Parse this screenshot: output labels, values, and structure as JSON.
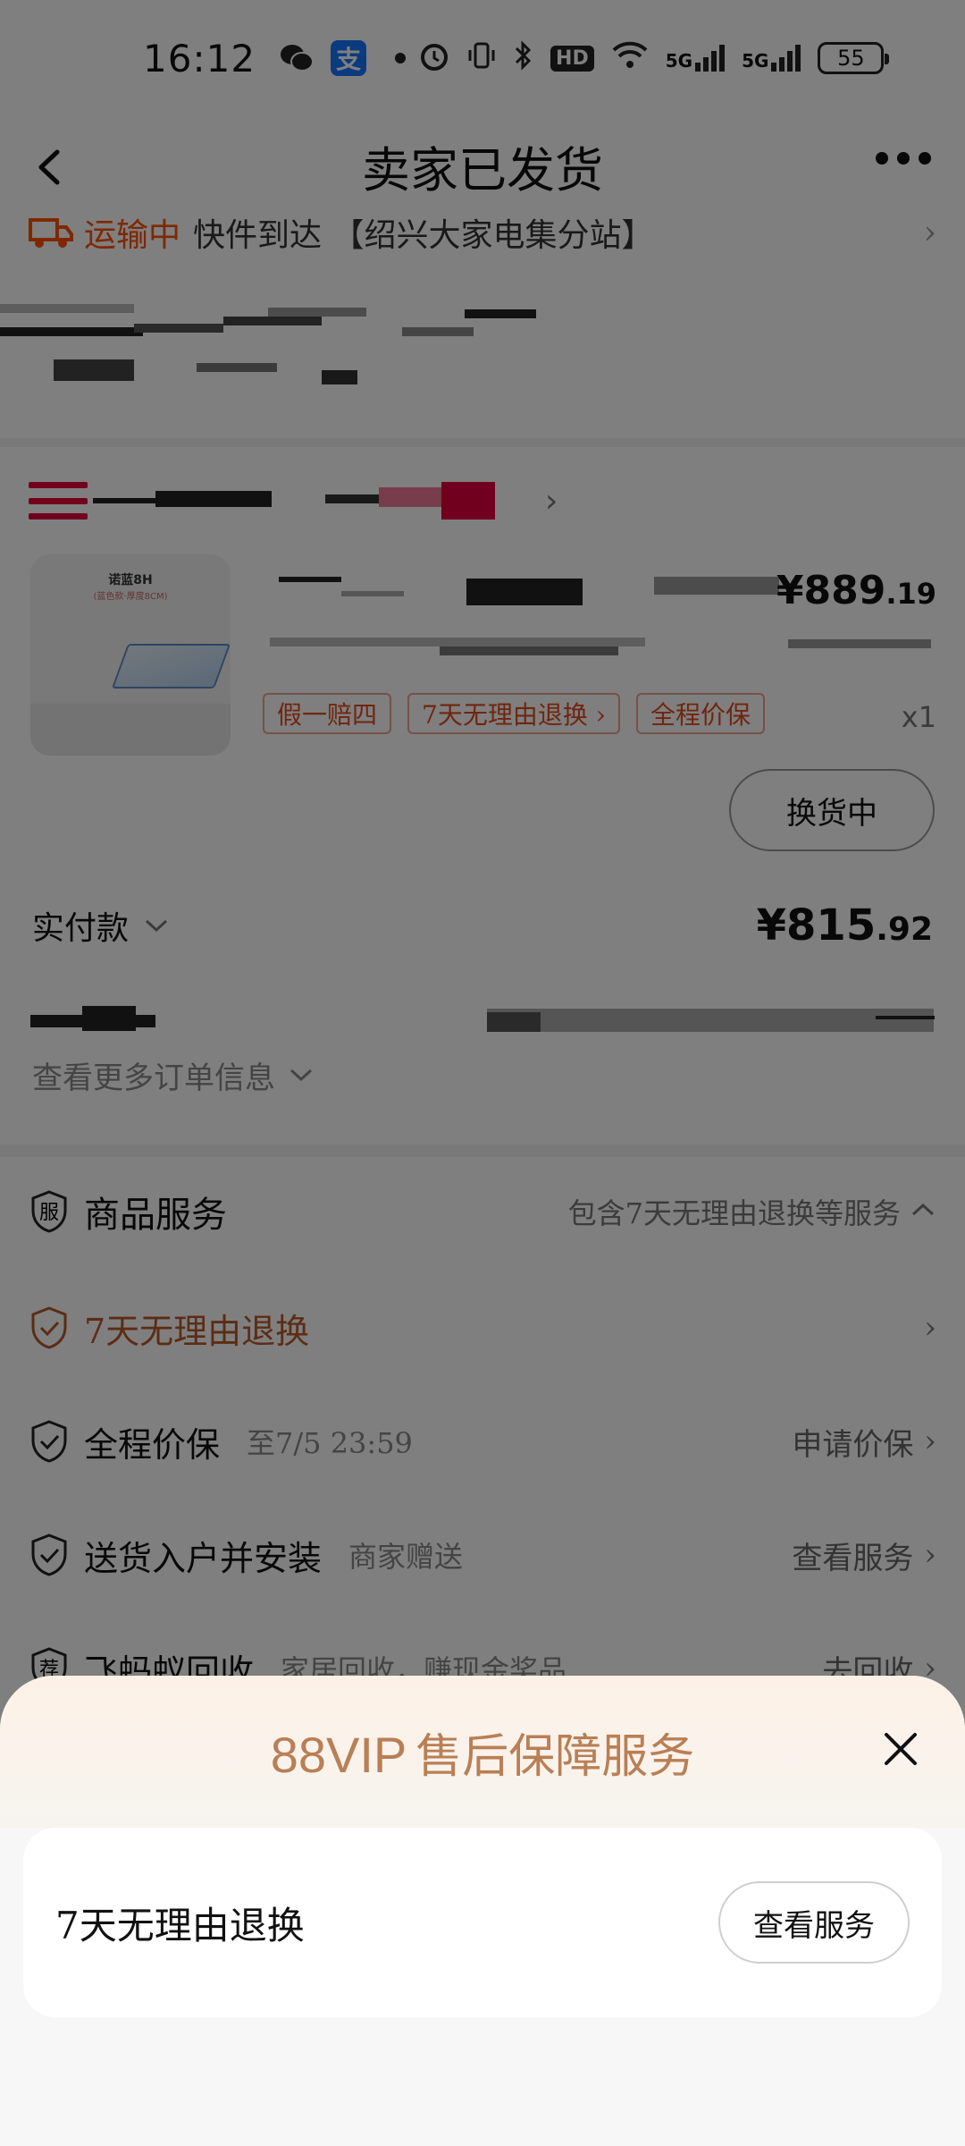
{
  "status_bar": {
    "time": "16:12",
    "alipay_glyph": "支",
    "hd_label": "HD",
    "signal_1": "5G",
    "signal_2": "5G",
    "battery": "55"
  },
  "nav": {
    "title": "卖家已发货"
  },
  "logistics": {
    "status": "运输中",
    "text": "快件到达 【绍兴大家电集分站】"
  },
  "product": {
    "image_brand": "诺蓝8H",
    "image_sub": "(蓝色款·厚度8CM)",
    "price_main": "¥889",
    "price_decimal": ".19",
    "tags": [
      "假一赔四",
      "7天无理由退换 ›",
      "全程价保"
    ],
    "qty": "x1"
  },
  "exchange_button": "换货中",
  "payment": {
    "label": "实付款",
    "price_main": "¥815",
    "price_decimal": ".92"
  },
  "more_info": "查看更多订单信息",
  "services": {
    "header": {
      "badge": "服",
      "title": "商品服务",
      "summary": "包含7天无理由退换等服务"
    },
    "rows": [
      {
        "name": "7天无理由退换",
        "sub": "",
        "action": ""
      },
      {
        "name": "全程价保",
        "sub": "至7/5 23:59",
        "action": "申请价保"
      },
      {
        "name": "送货入户并安装",
        "sub": "商家赠送",
        "action": "查看服务"
      },
      {
        "badge": "荐",
        "name": "飞蚂蚁回收",
        "sub": "家居回收，赚现金奖品",
        "action": "去回收"
      }
    ]
  },
  "sheet": {
    "title_vip": "88VIP",
    "title_rest": "售后保障服务",
    "item_label": "7天无理由退换",
    "item_button": "查看服务"
  },
  "colors": {
    "accent_orange": "#ff5000",
    "tag_red": "#e14a1e",
    "vip_gold": "#b97f55",
    "overlay": "rgba(0,0,0,0.5)"
  }
}
